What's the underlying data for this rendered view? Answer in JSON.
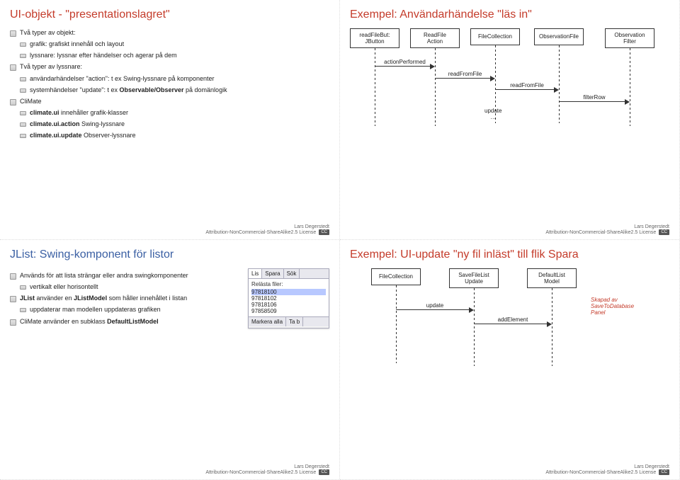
{
  "footer": {
    "author": "Lars Degerstedt",
    "license": "Attribution-NonCommercial-ShareAlike2.5 License",
    "cc": "CC"
  },
  "slide1": {
    "title": "UI-objekt - \"presentationslagret\"",
    "items": [
      "Två typer av objekt:",
      "grafik: grafiskt innehåll och layout",
      "lyssnare: lyssnar efter händelser och agerar på dem",
      "Två typer av lyssnare:",
      "användarhändelser \"action\": t ex Swing-lyssnare på komponenter",
      "systemhändelser \"update\": t ex Observable/Observer på domänlogik",
      "CliMate",
      "climate.ui innehåller grafik-klasser",
      "climate.ui.action Swing-lyssnare",
      "climate.ui.update Observer-lyssnare"
    ]
  },
  "slide2": {
    "title": "Exempel: Användarhändelse \"läs in\"",
    "lifelines": [
      "readFileBut:\nJButton",
      "ReadFile\nAction",
      "FileCollection",
      "ObservationFile",
      "Observation\nFilter"
    ],
    "msgs": [
      "actionPerformed",
      "readFromFile",
      "readFromFile",
      "filterRow",
      "update\n…"
    ]
  },
  "slide3": {
    "title": "JList: Swing-komponent för listor",
    "items": [
      "Används för att lista strängar eller andra swingkomponenter",
      "vertikalt eller horisontellt",
      "JList använder en JListModel som håller innehållet i listan",
      "uppdaterar man modellen uppdateras grafiken",
      "CliMate använder en subklass DefaultListModel"
    ],
    "panel": {
      "tabs": [
        "Lis",
        "Spara",
        "Sök"
      ],
      "label": "Relästa filer:",
      "list": [
        "97818100",
        "97818102",
        "97818106",
        "97858509"
      ],
      "btns": [
        "Markera alla",
        "Ta b"
      ]
    }
  },
  "slide4": {
    "title": "Exempel: UI-update \"ny fil inläst\" till flik Spara",
    "lifelines": [
      "FileCollection",
      "SaveFileList\nUpdate",
      "DefaultList\nModel"
    ],
    "msgs": [
      "update",
      "addElement"
    ],
    "note": "Skapad av\nSaveToDatabase\nPanel"
  }
}
